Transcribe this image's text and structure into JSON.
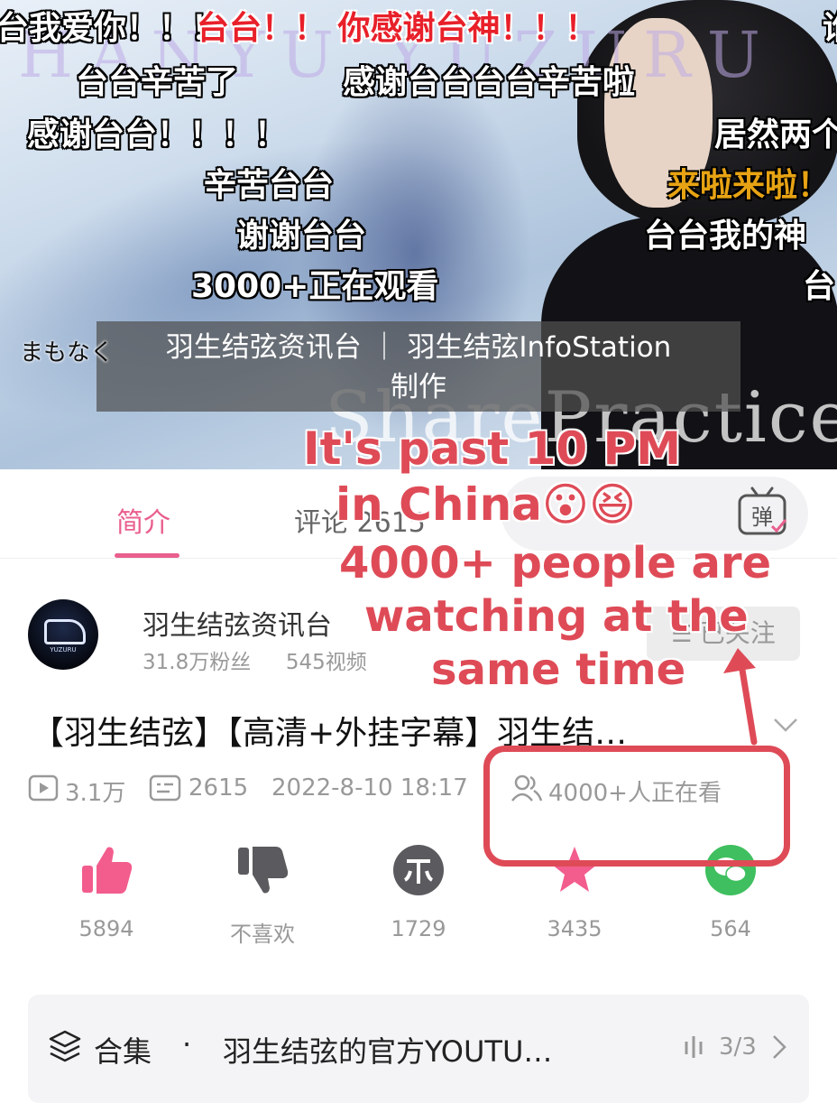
{
  "video": {
    "watermark_top": "HANYU YUZURU",
    "watermark_bottom": "SharePractice",
    "caption_line1": "羽生结弦资讯台 ｜ 羽生结弦InfoStation",
    "caption_line2": "制作",
    "danmaku": [
      "台我爱你！！！",
      "台台！！ 你感谢台神！！！",
      "台台辛苦了",
      "感谢台台台台辛苦啦",
      "感谢台台！！！！",
      "居然两个",
      "辛苦台台",
      "来啦来啦！",
      "谢谢台台",
      "台台我的神",
      "3000+正在观看",
      "台",
      "まもなく",
      "谁"
    ]
  },
  "tabs": {
    "intro": "简介",
    "comments": "评论 2615"
  },
  "danmu_button": {
    "label": "弹"
  },
  "uploader": {
    "name": "羽生结弦资讯台",
    "fans": "31.8万粉丝",
    "videos": "545视频",
    "follow_label": "已关注"
  },
  "video_info": {
    "title": "【羽生结弦】【高清+外挂字幕】羽生结…",
    "plays": "3.1万",
    "danmaku_count": "2615",
    "datetime": "2022-8-10  18:17",
    "watching": "4000+人正在看"
  },
  "actions": {
    "like": "5894",
    "dislike": "不喜欢",
    "coin": "1729",
    "favorite": "3435",
    "share": "564"
  },
  "collection": {
    "label": "合集",
    "separator": "·",
    "title": "羽生结弦的官方YOUTU…",
    "count": "3/3"
  },
  "annotation": {
    "line1": "It's past 10 PM",
    "line2": "in China😮😆",
    "line3": "4000+ people are",
    "line4": "watching at the",
    "line5": "same time"
  },
  "colors": {
    "accent_pink": "#e95f8d",
    "annotation_red": "#de4b57",
    "like_pink": "#f25d8e",
    "coin_gray": "#5b5b5f",
    "star_pink": "#f25d8e",
    "wechat_green": "#3fbf5f"
  }
}
